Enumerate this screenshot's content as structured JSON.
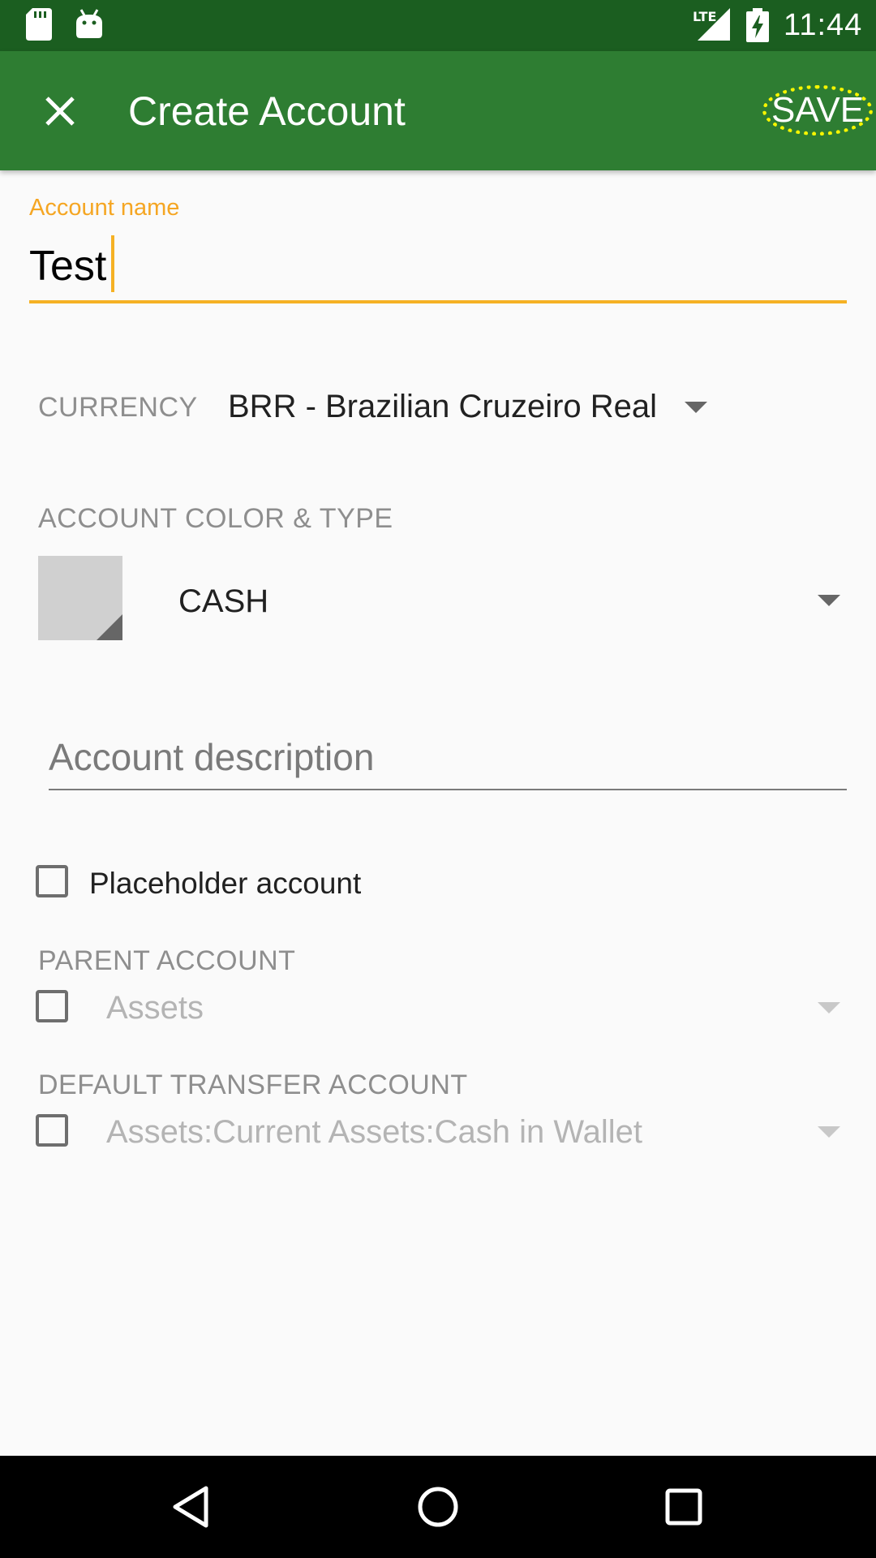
{
  "status_bar": {
    "time": "11:44",
    "network": "LTE",
    "icons": [
      "sd-card-icon",
      "android-icon",
      "signal-icon",
      "battery-charging-icon"
    ]
  },
  "app_bar": {
    "close_icon": "close-icon",
    "title": "Create Account",
    "save_label": "SAVE",
    "background": "#2e7d32"
  },
  "form": {
    "account_name": {
      "label": "Account name",
      "value": "Test"
    },
    "currency": {
      "label": "CURRENCY",
      "value": "BRR - Brazilian Cruzeiro Real"
    },
    "color_type": {
      "label": "ACCOUNT COLOR & TYPE",
      "swatch_color": "#d0d0d0",
      "type_value": "CASH"
    },
    "description": {
      "placeholder": "Account description"
    },
    "placeholder_account": {
      "label": "Placeholder account",
      "checked": false
    },
    "parent_account": {
      "label": "PARENT ACCOUNT",
      "value": "Assets",
      "checked": false,
      "enabled": false
    },
    "default_transfer": {
      "label": "DEFAULT TRANSFER ACCOUNT",
      "value": "Assets:Current Assets:Cash in Wallet",
      "checked": false,
      "enabled": false
    }
  },
  "colors": {
    "accent": "#f5b124",
    "status_bar": "#1b5e20"
  },
  "nav_bar": {
    "icons": [
      "back-icon",
      "home-icon",
      "recents-icon"
    ]
  }
}
